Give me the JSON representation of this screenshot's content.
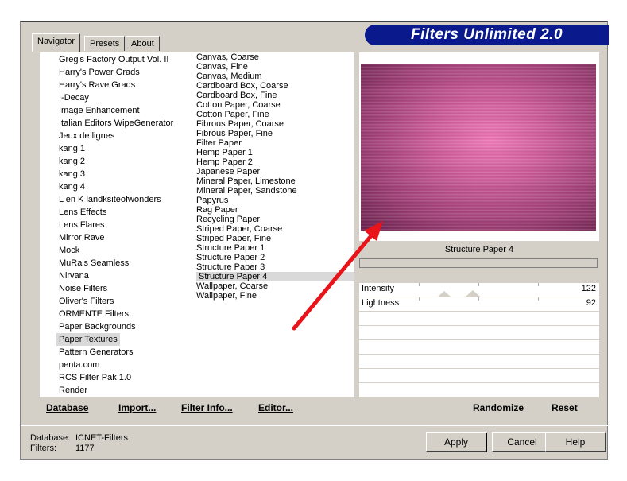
{
  "tabs": [
    "Navigator",
    "Presets",
    "About"
  ],
  "banner": "Filters Unlimited 2.0",
  "categories": [
    "Greg's Factory Output Vol. II",
    "Harry's Power Grads",
    "Harry's Rave Grads",
    "I-Decay",
    "Image Enhancement",
    "Italian Editors WipeGenerator",
    "Jeux de lignes",
    "kang 1",
    "kang 2",
    "kang 3",
    "kang 4",
    "L en K landksiteofwonders",
    "Lens Effects",
    "Lens Flares",
    "Mirror Rave",
    "Mock",
    "MuRa's Seamless",
    "Nirvana",
    "Noise Filters",
    "Oliver's Filters",
    "ORMENTE Filters",
    "Paper Backgrounds",
    "Paper Textures",
    "Pattern Generators",
    "penta.com",
    "RCS Filter Pak 1.0",
    "Render"
  ],
  "selected_category": "Paper Textures",
  "filters": [
    "Canvas, Coarse",
    "Canvas, Fine",
    "Canvas, Medium",
    "Cardboard Box, Coarse",
    "Cardboard Box, Fine",
    "Cotton Paper, Coarse",
    "Cotton Paper, Fine",
    "Fibrous Paper, Coarse",
    "Fibrous Paper, Fine",
    "Filter Paper",
    "Hemp Paper 1",
    "Hemp Paper 2",
    "Japanese Paper",
    "Mineral Paper, Limestone",
    "Mineral Paper, Sandstone",
    "Papyrus",
    "Rag Paper",
    "Recycling Paper",
    "Striped Paper, Coarse",
    "Striped Paper, Fine",
    "Structure Paper 1",
    "Structure Paper 2",
    "Structure Paper 3",
    "Structure Paper 4",
    "Wallpaper, Coarse",
    "Wallpaper, Fine"
  ],
  "selected_filter": "Structure Paper 4",
  "preview_name": "Structure Paper 4",
  "params": [
    {
      "label": "Intensity",
      "value": "122",
      "level": 122
    },
    {
      "label": "Lightness",
      "value": "92",
      "level": 92
    }
  ],
  "actions": {
    "database": "Database",
    "import": "Import...",
    "filter_info": "Filter Info...",
    "editor": "Editor...",
    "randomize": "Randomize",
    "reset": "Reset"
  },
  "status": {
    "database_label": "Database:",
    "database_value": "ICNET-Filters",
    "filters_label": "Filters:",
    "filters_value": "1177"
  },
  "buttons": {
    "apply": "Apply",
    "cancel": "Cancel",
    "help": "Help"
  },
  "colors": {
    "banner": "#0a1a8c",
    "arrow": "#e8141a",
    "dialog": "#d4d0c8"
  },
  "icons": {
    "scroll_up": "scroll-up-arrow-icon",
    "scroll_down": "scroll-down-arrow-icon"
  }
}
